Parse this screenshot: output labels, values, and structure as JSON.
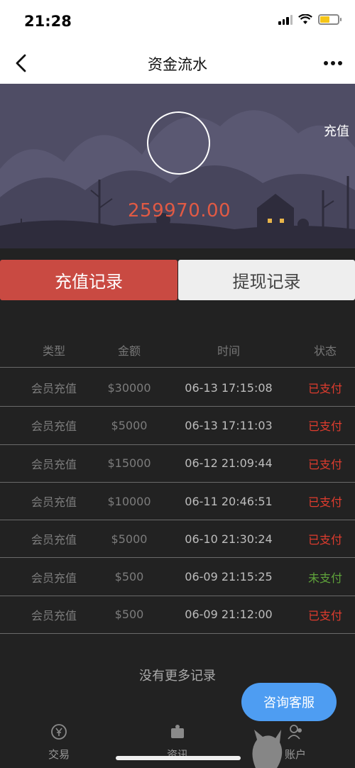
{
  "status_bar": {
    "time": "21:28"
  },
  "nav": {
    "title": "资金流水",
    "back_icon": "chevron-left-icon",
    "more_icon": "more-dots-icon"
  },
  "banner": {
    "balance": "259970.00",
    "recharge_label": "充值"
  },
  "tabs": {
    "recharge": "充值记录",
    "withdraw": "提现记录"
  },
  "table": {
    "headers": [
      "类型",
      "金额",
      "时间",
      "状态"
    ],
    "rows": [
      {
        "type": "会员充值",
        "amount": "$30000",
        "time": "06-13 17:15:08",
        "status": "已支付"
      },
      {
        "type": "会员充值",
        "amount": "$5000",
        "time": "06-13 17:11:03",
        "status": "已支付"
      },
      {
        "type": "会员充值",
        "amount": "$15000",
        "time": "06-12 21:09:44",
        "status": "已支付"
      },
      {
        "type": "会员充值",
        "amount": "$10000",
        "time": "06-11 20:46:51",
        "status": "已支付"
      },
      {
        "type": "会员充值",
        "amount": "$5000",
        "time": "06-10 21:30:24",
        "status": "已支付"
      },
      {
        "type": "会员充值",
        "amount": "$500",
        "time": "06-09 21:15:25",
        "status": "未支付"
      },
      {
        "type": "会员充值",
        "amount": "$500",
        "time": "06-09 21:12:00",
        "status": "已支付"
      }
    ]
  },
  "no_more": "没有更多记录",
  "service_button": "咨询客服",
  "tabbar": [
    {
      "label": "交易",
      "icon": "yen-exchange-icon"
    },
    {
      "label": "资讯",
      "icon": "news-icon"
    },
    {
      "label": "账户",
      "icon": "account-icon"
    }
  ],
  "colors": {
    "paid": "#e03c2e",
    "unpaid": "#5fa33b",
    "accent": "#c94a42",
    "service": "#4e9df2"
  }
}
